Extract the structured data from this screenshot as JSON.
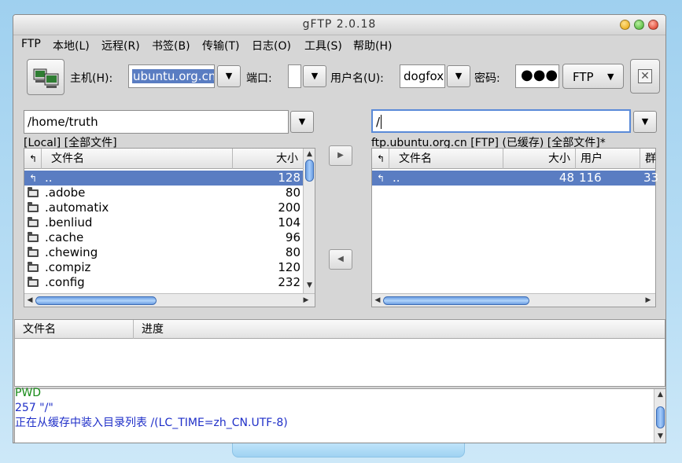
{
  "window": {
    "title": "gFTP 2.0.18"
  },
  "menu": [
    "FTP",
    "本地(L)",
    "远程(R)",
    "书签(B)",
    "传输(T)",
    "日志(O)",
    "工具(S)",
    "帮助(H)"
  ],
  "toolbar": {
    "host_label": "主机(H):",
    "host_value": "ubuntu.org.cn",
    "port_label": "端口:",
    "port_value": "",
    "user_label": "用户名(U):",
    "user_value": "dogfox",
    "password_label": "密码:",
    "password_value": "●●●",
    "protocol": "FTP"
  },
  "local": {
    "path": "/home/truth",
    "status": "[Local] [全部文件]",
    "columns": [
      "文件名",
      "大小"
    ],
    "rows": [
      {
        "name": "..",
        "size": "128",
        "type": "up",
        "selected": true
      },
      {
        "name": ".adobe",
        "size": "80",
        "type": "folder"
      },
      {
        "name": ".automatix",
        "size": "200",
        "type": "folder"
      },
      {
        "name": ".benliud",
        "size": "104",
        "type": "folder"
      },
      {
        "name": ".cache",
        "size": "96",
        "type": "folder"
      },
      {
        "name": ".chewing",
        "size": "80",
        "type": "folder"
      },
      {
        "name": ".compiz",
        "size": "120",
        "type": "folder"
      },
      {
        "name": ".config",
        "size": "232",
        "type": "folder"
      }
    ]
  },
  "remote": {
    "path": "/",
    "status": "ftp.ubuntu.org.cn [FTP] (已缓存) [全部文件]*",
    "columns": [
      "文件名",
      "大小",
      "用户",
      "群"
    ],
    "rows": [
      {
        "name": "..",
        "size": "48",
        "user": "116",
        "group": "33",
        "type": "up",
        "selected": true
      }
    ]
  },
  "transfers": {
    "columns": [
      "文件名",
      "进度"
    ]
  },
  "log": [
    {
      "text": "PWD",
      "color": "#168a16"
    },
    {
      "text": "257 \"/\"",
      "color": "#1f2fc8"
    },
    {
      "text": "正在从缓存中装入目录列表 /(LC_TIME=zh_CN.UTF-8)",
      "color": "#1f2fc8"
    }
  ]
}
